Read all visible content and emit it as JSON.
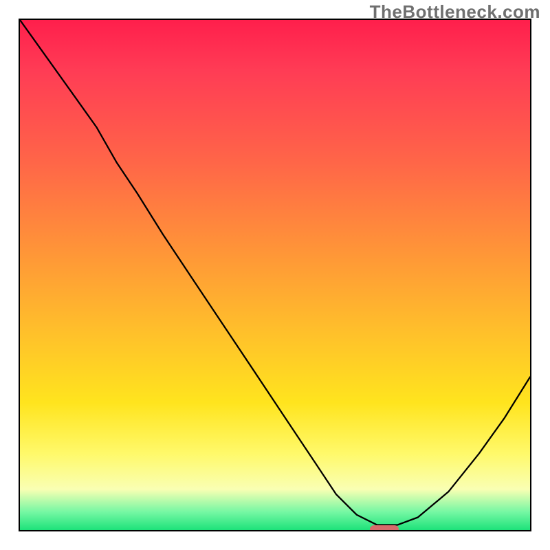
{
  "watermark": "TheBottleneck.com",
  "chart_data": {
    "type": "line",
    "title": "",
    "xlabel": "",
    "ylabel": "",
    "x": [
      0.0,
      0.05,
      0.1,
      0.15,
      0.19,
      0.23,
      0.28,
      0.34,
      0.4,
      0.46,
      0.52,
      0.58,
      0.62,
      0.66,
      0.7,
      0.74,
      0.78,
      0.84,
      0.9,
      0.95,
      1.0
    ],
    "values": [
      1.0,
      0.93,
      0.86,
      0.79,
      0.72,
      0.66,
      0.58,
      0.49,
      0.4,
      0.31,
      0.22,
      0.13,
      0.07,
      0.03,
      0.01,
      0.01,
      0.025,
      0.075,
      0.15,
      0.22,
      0.3
    ],
    "xlim": [
      0,
      1
    ],
    "ylim": [
      0,
      1
    ],
    "marker": {
      "x": 0.71,
      "y": 0.0
    },
    "background_gradient": {
      "stops": [
        {
          "pos": 0.0,
          "color": "#ff1f4c"
        },
        {
          "pos": 0.28,
          "color": "#ff6648"
        },
        {
          "pos": 0.62,
          "color": "#ffc22a"
        },
        {
          "pos": 0.85,
          "color": "#fff96a"
        },
        {
          "pos": 0.96,
          "color": "#74f7a3"
        },
        {
          "pos": 1.0,
          "color": "#1de27a"
        }
      ]
    }
  }
}
